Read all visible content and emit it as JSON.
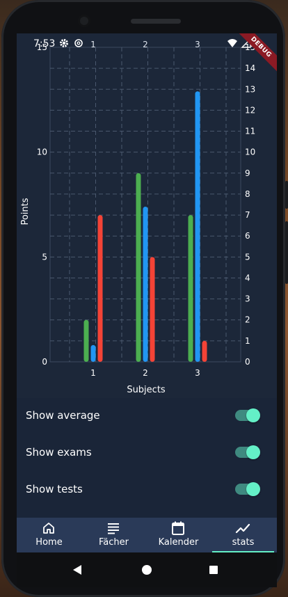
{
  "status_bar": {
    "time": "7:53",
    "debug_label": "DEBUG"
  },
  "colors": {
    "exams": "#4caf50",
    "tests": "#2196f3",
    "average": "#f44336",
    "accent": "#64f0c7",
    "background": "#1c2739"
  },
  "chart_data": {
    "type": "bar",
    "categories": [
      "1",
      "2",
      "3"
    ],
    "xlabel": "Subjects",
    "ylabel": "Points",
    "ylim": [
      0,
      15
    ],
    "left_ticks": [
      "0",
      "5",
      "10",
      "15"
    ],
    "right_ticks": [
      "0",
      "1",
      "2",
      "3",
      "4",
      "5",
      "6",
      "7",
      "8",
      "9",
      "10",
      "11",
      "12",
      "13",
      "14",
      "15"
    ],
    "top_labels": [
      "1",
      "2",
      "3"
    ],
    "grid": true,
    "series": [
      {
        "values": [
          2,
          9,
          7
        ],
        "color": "#4caf50"
      },
      {
        "values": [
          0.8,
          7.4,
          12.9
        ],
        "color": "#2196f3"
      },
      {
        "values": [
          7,
          5,
          1
        ],
        "color": "#f44336"
      }
    ]
  },
  "settings": [
    {
      "label": "Show average",
      "on": true
    },
    {
      "label": "Show exams",
      "on": true
    },
    {
      "label": "Show tests",
      "on": true
    }
  ],
  "bottom_nav": [
    {
      "label": "Home",
      "icon": "home-icon",
      "active": false
    },
    {
      "label": "Fächer",
      "icon": "list-icon",
      "active": false
    },
    {
      "label": "Kalender",
      "icon": "calendar-icon",
      "active": false
    },
    {
      "label": "stats",
      "icon": "trending-up-icon",
      "active": true
    }
  ]
}
